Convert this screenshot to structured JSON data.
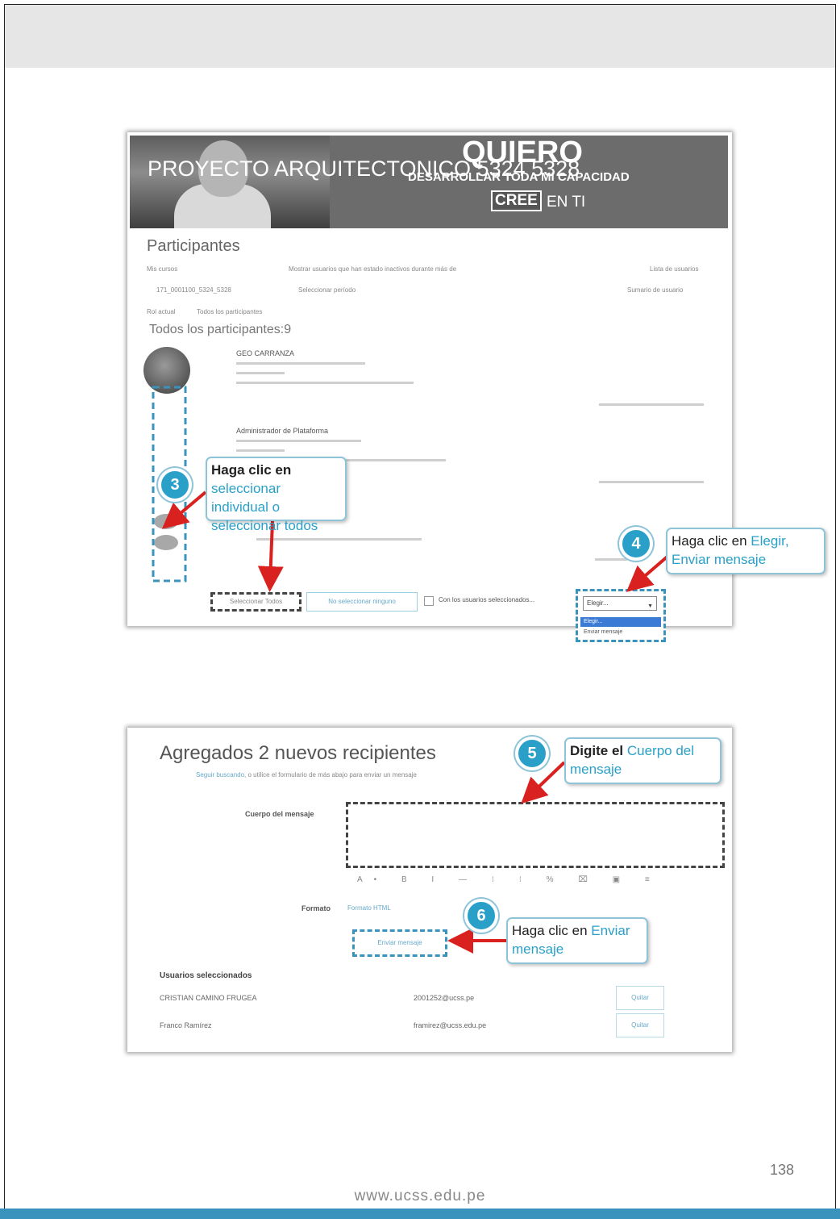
{
  "page": {
    "page_number": "138",
    "footer_url": "www.ucss.edu.pe"
  },
  "screenshot1": {
    "banner": {
      "course": "PROYECTO ARQUITECTONICO 5324 5328",
      "headline": "QUIERO",
      "subheadline": "DESARROLLAR TODA MI CAPACIDAD",
      "brand_box": "CREE",
      "brand_rest": "EN TI"
    },
    "title": "Participantes",
    "filters": {
      "label_course": "Mis cursos",
      "label_period": "Mostrar usuarios que han estado inactivos durante más de",
      "label_list": "Lista de usuarios",
      "course_value": "171_0001100_5324_5328",
      "period_value": "Seleccionar período",
      "list_value": "Sumario de usuario",
      "role_label": "Rol actual",
      "role_value": "Todos los participantes"
    },
    "all_participants": "Todos los participantes:9",
    "users": [
      {
        "name": "GEO CARRANZA"
      },
      {
        "name": "Administrador de Plataforma"
      }
    ],
    "buttons": {
      "select_all": "Seleccionar Todos",
      "select_none": "No seleccionar ninguno",
      "with_selected": "Con los usuarios seleccionados..."
    },
    "dropdown": {
      "selected": "Elegir...",
      "options": [
        "Elegir...",
        "Enviar mensaje"
      ]
    }
  },
  "callouts": {
    "c3": {
      "number": "3",
      "lead": "Haga clic en",
      "highlight": "seleccionar individual o seleccionar todos"
    },
    "c4": {
      "number": "4",
      "lead": "Haga clic en",
      "highlight": "Elegir, Enviar mensaje"
    },
    "c5": {
      "number": "5",
      "lead": "Digite el",
      "highlight": "Cuerpo del mensaje"
    },
    "c6": {
      "number": "6",
      "lead": "Haga clic en",
      "highlight": "Enviar mensaje"
    }
  },
  "screenshot2": {
    "title": "Agregados 2 nuevos recipientes",
    "subtitle_link": "Seguir buscando",
    "subtitle_rest": ", o utilice el formulario de más abajo para enviar un mensaje",
    "body_label": "Cuerpo del mensaje",
    "toolbar": "A• B I — ⁝ ⁝ % ⌧ ▣ ≡",
    "format_label": "Formato",
    "format_value": "Formato HTML",
    "send_button": "Enviar mensaje",
    "selected_heading": "Usuarios seleccionados",
    "selected_users": [
      {
        "name": "CRISTIAN CAMINO FRUGEA",
        "email": "2001252@ucss.pe",
        "remove": "Quitar"
      },
      {
        "name": "Franco Ramírez",
        "email": "framirez@ucss.edu.pe",
        "remove": "Quitar"
      }
    ]
  }
}
